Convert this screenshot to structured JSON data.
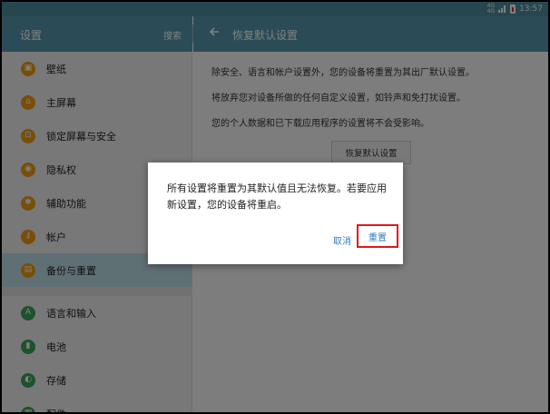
{
  "status_bar": {
    "network": "4G",
    "network_sub": "4G",
    "time": "13:57",
    "colors": {
      "bar": "#4f8ea1",
      "battery_fill": "#d32f2f"
    }
  },
  "left_header": {
    "title": "设置",
    "search_label": "搜索"
  },
  "right_header": {
    "back_icon": "arrow-left-icon",
    "title": "恢复默认设置"
  },
  "sidebar": {
    "items": [
      {
        "label": "壁纸",
        "icon": "wallpaper-icon",
        "color": "#f39c12"
      },
      {
        "label": "主屏幕",
        "icon": "home-icon",
        "color": "#f39c12"
      },
      {
        "label": "锁定屏幕与安全",
        "icon": "lock-icon",
        "color": "#f39c12"
      },
      {
        "label": "隐私权",
        "icon": "privacy-icon",
        "color": "#f39c12"
      },
      {
        "label": "辅助功能",
        "icon": "accessibility-icon",
        "color": "#f39c12"
      },
      {
        "label": "帐户",
        "icon": "key-icon",
        "color": "#f39c12"
      },
      {
        "label": "备份与重置",
        "icon": "backup-icon",
        "color": "#f39c12",
        "active": true
      },
      {
        "label": "语言和输入",
        "icon": "language-icon",
        "color": "#3aa45a"
      },
      {
        "label": "电池",
        "icon": "battery-icon",
        "color": "#3aa45a"
      },
      {
        "label": "存储",
        "icon": "storage-icon",
        "color": "#3aa45a"
      },
      {
        "label": "配件",
        "icon": "accessory-icon",
        "color": "#3aa45a"
      }
    ]
  },
  "content": {
    "line1": "除安全、语言和帐户设置外，您的设备将重置为其出厂默认设置。",
    "line2": "将放弃您对设备所做的任何自定义设置，如铃声和免打扰设置。",
    "line3": "您的个人数据和已下载应用程序的设置将不会受影响。",
    "reset_button": "恢复默认设置"
  },
  "dialog": {
    "message": "所有设置将重置为其默认值且无法恢复。若要应用新设置，您的设备将重启。",
    "cancel": "取消",
    "confirm": "重置",
    "colors": {
      "action": "#2b7fbf",
      "highlight": "#e01818"
    }
  }
}
